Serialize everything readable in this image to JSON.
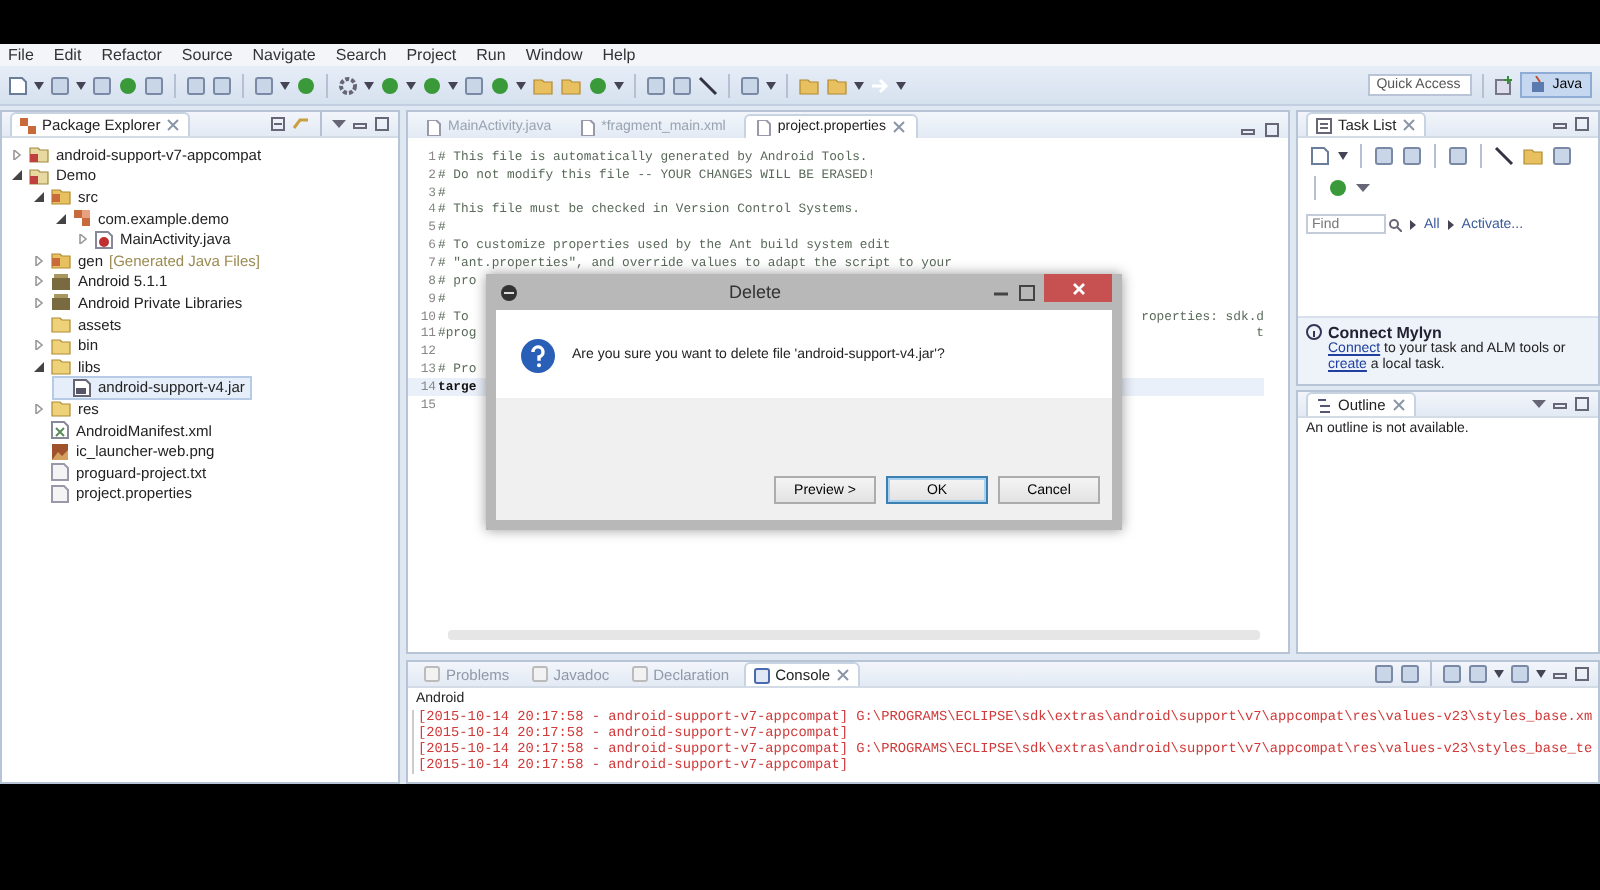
{
  "menu": [
    "File",
    "Edit",
    "Refactor",
    "Source",
    "Navigate",
    "Search",
    "Project",
    "Run",
    "Window",
    "Help"
  ],
  "toolbar": {
    "quick_access": {
      "placeholder": "Quick Access"
    },
    "perspective": {
      "label": "Java",
      "selected": true
    }
  },
  "package_explorer": {
    "title": "Package Explorer",
    "tree": [
      {
        "label": "android-support-v7-appcompat",
        "kind": "project",
        "expanded": false,
        "selected": false
      },
      {
        "label": "Demo",
        "kind": "project",
        "expanded": true,
        "selected": false,
        "children": [
          {
            "label": "src",
            "kind": "source",
            "expanded": true,
            "selected": false,
            "children": [
              {
                "label": "com.example.demo",
                "kind": "package",
                "expanded": true,
                "selected": false,
                "children": [
                  {
                    "label": "MainActivity.java",
                    "kind": "java",
                    "expanded": false,
                    "selected": false
                  }
                ]
              }
            ]
          },
          {
            "label": "gen",
            "decoration": "[Generated Java Files]",
            "kind": "source",
            "expanded": false,
            "selected": false
          },
          {
            "label": "Android 5.1.1",
            "kind": "library",
            "expanded": false,
            "selected": false
          },
          {
            "label": "Android Private Libraries",
            "kind": "library",
            "expanded": false,
            "selected": false
          },
          {
            "label": "assets",
            "kind": "folder",
            "selected": false
          },
          {
            "label": "bin",
            "kind": "folder",
            "expanded": false,
            "selected": false
          },
          {
            "label": "libs",
            "kind": "folder",
            "expanded": true,
            "selected": false,
            "children": [
              {
                "label": "android-support-v4.jar",
                "kind": "jar",
                "selected": true
              }
            ]
          },
          {
            "label": "res",
            "kind": "folder",
            "expanded": false,
            "selected": false
          },
          {
            "label": "AndroidManifest.xml",
            "kind": "xml",
            "selected": false
          },
          {
            "label": "ic_launcher-web.png",
            "kind": "image",
            "selected": false
          },
          {
            "label": "proguard-project.txt",
            "kind": "file",
            "selected": false
          },
          {
            "label": "project.properties",
            "kind": "file",
            "selected": false
          }
        ]
      }
    ]
  },
  "editor": {
    "tabs": [
      {
        "label": "MainActivity.java",
        "selected": false
      },
      {
        "label": "*fragment_main.xml",
        "selected": false
      },
      {
        "label": "project.properties",
        "selected": true
      }
    ],
    "lines": [
      {
        "number": "1",
        "text": "# This file is automatically generated by Android Tools.",
        "bold": false
      },
      {
        "number": "2",
        "text": "# Do not modify this file -- YOUR CHANGES WILL BE ERASED!",
        "bold": false
      },
      {
        "number": "3",
        "text": "#",
        "bold": false
      },
      {
        "number": "4",
        "text": "# This file must be checked in Version Control Systems.",
        "bold": false
      },
      {
        "number": "5",
        "text": "#",
        "bold": false
      },
      {
        "number": "6",
        "text": "# To customize properties used by the Ant build system edit",
        "bold": false
      },
      {
        "number": "7",
        "text": "# \"ant.properties\", and override values to adapt the script to your",
        "bold": false
      },
      {
        "number": "8",
        "text": "# pro",
        "bold": false
      },
      {
        "number": "9",
        "text": "#",
        "bold": false
      },
      {
        "number": "10",
        "text": "# To",
        "tail": "roperties: sdk.d",
        "bold": false
      },
      {
        "number": "11",
        "text": "#prog",
        "tail": "t",
        "bold": false
      },
      {
        "number": "12"
      },
      {
        "number": "13",
        "text": "# Pro",
        "bold": false
      },
      {
        "number": "14",
        "text": "targe",
        "bold": true
      },
      {
        "number": "15"
      }
    ]
  },
  "task_list": {
    "title": "Task List",
    "find": {
      "placeholder": "Find"
    },
    "filters": [
      "All",
      "Activate..."
    ],
    "mylyn": {
      "title": "Connect Mylyn",
      "message": [
        {
          "text": "Connect",
          "link": true
        },
        {
          "text": " to your task and ALM tools or ",
          "link": false
        },
        {
          "text": "create",
          "link": true
        },
        {
          "text": " a local task.",
          "link": false
        }
      ]
    }
  },
  "outline": {
    "title": "Outline",
    "message": "An outline is not available."
  },
  "bottom": {
    "tabs": [
      {
        "label": "Problems",
        "selected": false
      },
      {
        "label": "Javadoc",
        "selected": false
      },
      {
        "label": "Declaration",
        "selected": false
      },
      {
        "label": "Console",
        "selected": true
      }
    ],
    "console_title": "Android",
    "lines": [
      "[2015-10-14 20:17:58 - android-support-v7-appcompat] G:\\PROGRAMS\\ECLIPSE\\sdk\\extras\\android\\support\\v7\\appcompat\\res\\values-v23\\styles_base.xm",
      "[2015-10-14 20:17:58 - android-support-v7-appcompat]",
      "[2015-10-14 20:17:58 - android-support-v7-appcompat] G:\\PROGRAMS\\ECLIPSE\\sdk\\extras\\android\\support\\v7\\appcompat\\res\\values-v23\\styles_base_te",
      "[2015-10-14 20:17:58 - android-support-v7-appcompat]"
    ]
  },
  "dialog": {
    "title": "Delete",
    "message": "Are you sure you want to delete file 'android-support-v4.jar'?",
    "buttons": [
      {
        "label": "Preview >",
        "default": false
      },
      {
        "label": "OK",
        "default": true
      },
      {
        "label": "Cancel",
        "default": false
      }
    ]
  }
}
